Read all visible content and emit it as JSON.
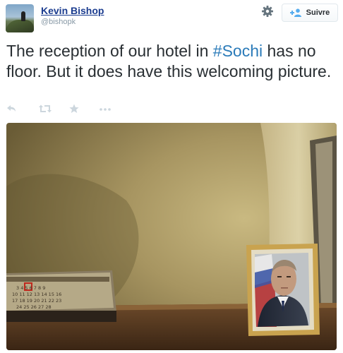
{
  "user": {
    "name": "Kevin Bishop",
    "handle": "@bishopk"
  },
  "follow_button": {
    "label": "Suivre"
  },
  "tweet": {
    "text_before": "The reception of our hotel in ",
    "hashtag": "#Sochi",
    "text_after": " has no floor. But it does have this welcoming picture."
  },
  "icons": {
    "settings": "gear-icon",
    "reply": "reply-icon",
    "retweet": "retweet-icon",
    "favorite": "star-icon",
    "more": "more-icon",
    "follow": "add-user-icon"
  },
  "colors": {
    "name_link": "#1b3c8f",
    "hashtag": "#2b7bb9",
    "muted": "#8899a6",
    "text": "#292f33"
  },
  "calendar": {
    "rows": [
      "3 4 5 6 7 8 9",
      "10 11 12 13 14 15 16",
      "17 18 19 20 21 22 23",
      "24 25 26 27 28"
    ]
  }
}
